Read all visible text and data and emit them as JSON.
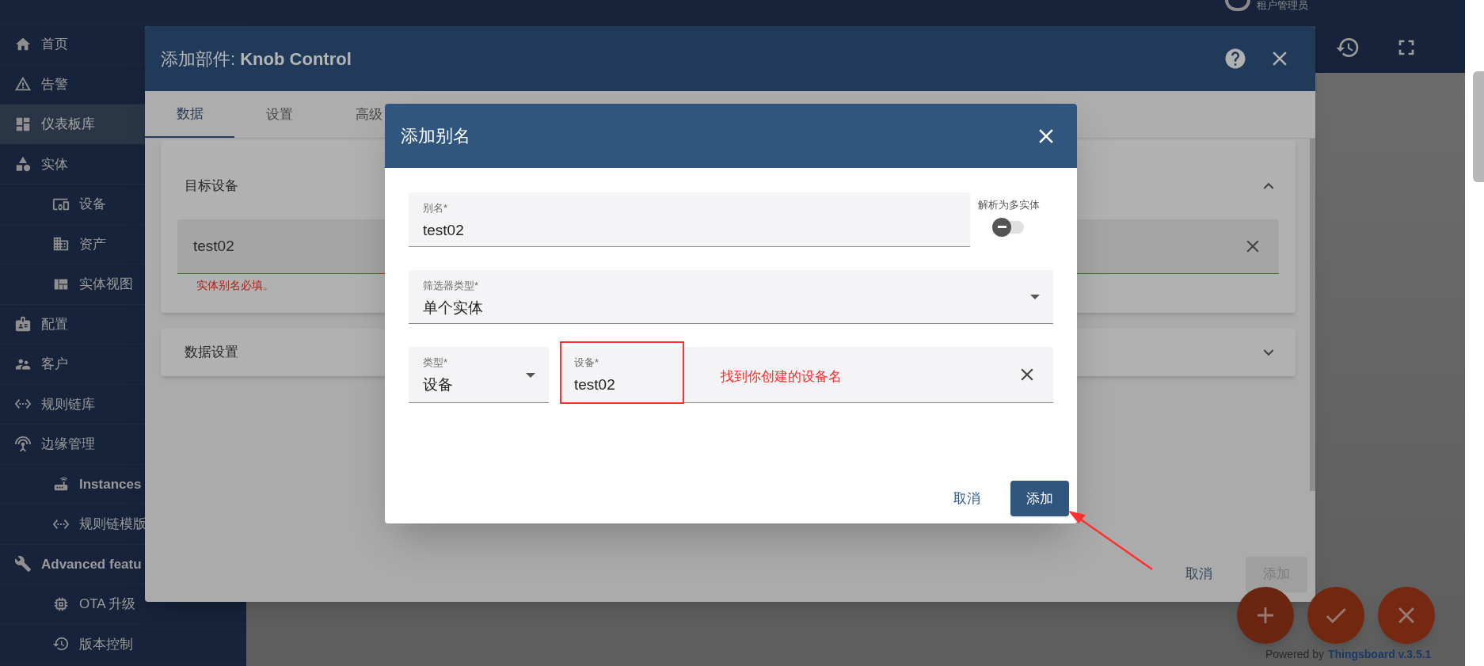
{
  "top_bar": {
    "user_role": "租户管理员"
  },
  "sidebar": {
    "items": [
      {
        "label": "首页",
        "selected": false
      },
      {
        "label": "告警",
        "selected": false
      },
      {
        "label": "仪表板库",
        "selected": true
      },
      {
        "label": "实体",
        "selected": false,
        "children": [
          {
            "label": "设备",
            "selected": false
          },
          {
            "label": "资产",
            "selected": false
          },
          {
            "label": "实体视图",
            "selected": false
          }
        ]
      },
      {
        "label": "配置",
        "selected": false
      },
      {
        "label": "客户",
        "selected": false
      },
      {
        "label": "规则链库",
        "selected": false
      },
      {
        "label": "边缘管理",
        "selected": false,
        "children": [
          {
            "label": "Instances",
            "selected": false
          },
          {
            "label": "规则链模版",
            "selected": false
          }
        ]
      },
      {
        "label": "Advanced featu",
        "selected": false,
        "children": [
          {
            "label": "OTA 升级",
            "selected": false
          },
          {
            "label": "版本控制",
            "selected": false
          }
        ]
      }
    ]
  },
  "widget_dialog": {
    "title": "添加部件: **Knob Control**",
    "tabs": [
      {
        "label": "数据",
        "selected": true
      },
      {
        "label": "设置",
        "selected": false
      },
      {
        "label": "高级",
        "selected": false
      }
    ],
    "sections": [
      {
        "title": "目标设备",
        "expanded": true,
        "field": {
          "value": "test02",
          "error": "实体别名必填。"
        }
      },
      {
        "title": "数据设置",
        "expanded": false
      }
    ],
    "buttons": [
      {
        "label": "取消",
        "disabled": false
      },
      {
        "label": "添加",
        "disabled": true
      }
    ]
  },
  "alias_dialog": {
    "title": "添加别名",
    "alias_field": {
      "label": "别名*",
      "value": "test02"
    },
    "multiple_toggle": {
      "label": "解析为多实体",
      "on": false
    },
    "filter_type": {
      "label": "筛选器类型*",
      "value": "单个实体"
    },
    "entity_type": {
      "label": "类型*",
      "value": "设备"
    },
    "entity": {
      "label": "设备*",
      "value": "test02"
    },
    "buttons": [
      {
        "label": "取消",
        "kind": "text"
      },
      {
        "label": "添加",
        "kind": "primary"
      }
    ]
  },
  "annotation": {
    "text": "找到你创建的设备名"
  },
  "footer": {
    "powered_by": "Powered by",
    "link": "Thingsboard v.3.5.1"
  }
}
